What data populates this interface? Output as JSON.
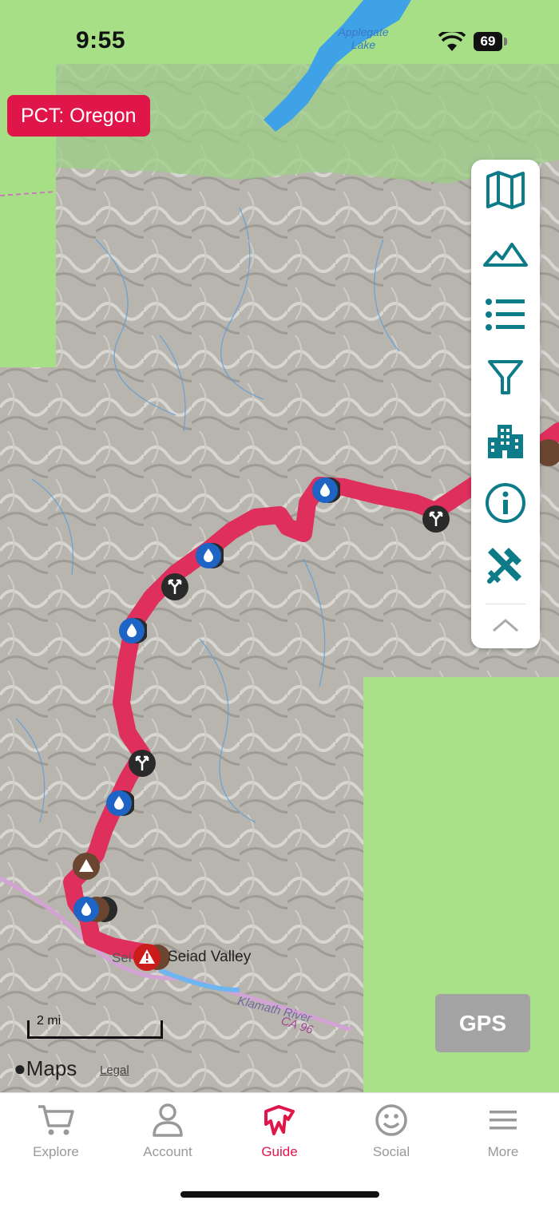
{
  "status": {
    "time": "9:55",
    "battery": "69"
  },
  "map": {
    "lake_label": "Applegate Lake",
    "region_badge": "PCT: Oregon",
    "place_primary": "Seiad Valley",
    "place_secondary": "Sei",
    "river_label": "Klamath River",
    "road_label": "CA 96",
    "scale_label": "2 mi",
    "attribution": "Maps",
    "legal_link": "Legal",
    "gps_button": "GPS"
  },
  "toolbar": {
    "items": [
      "map-icon",
      "mountains-icon",
      "list-icon",
      "filter-icon",
      "town-icon",
      "info-icon",
      "tools-icon",
      "chevron-up-icon"
    ]
  },
  "tabs": [
    {
      "label": "Explore",
      "icon": "cart-icon",
      "active": false
    },
    {
      "label": "Account",
      "icon": "person-icon",
      "active": false
    },
    {
      "label": "Guide",
      "icon": "guide-icon",
      "active": true
    },
    {
      "label": "Social",
      "icon": "smiley-icon",
      "active": false
    },
    {
      "label": "More",
      "icon": "menu-icon",
      "active": false
    }
  ],
  "colors": {
    "accent": "#e0164b",
    "toolbar_icon": "#0e7b88",
    "trail": "#df2f5c",
    "water_marker": "#1d64c4",
    "junction_marker": "#2a2a2a",
    "camp_marker": "#6a4630",
    "hazard_marker": "#cc1b1b"
  }
}
